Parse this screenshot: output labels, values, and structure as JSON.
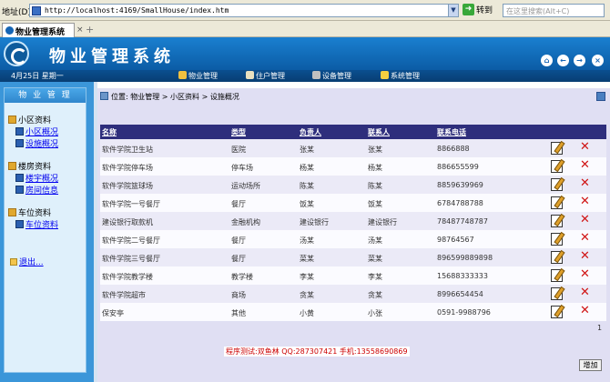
{
  "browser": {
    "address_label": "地址(D)",
    "url": "http://localhost:4169/SmallHouse/index.htm",
    "go_label": "转到",
    "search_placeholder": "在这里搜索(Alt+C)",
    "tab_title": "物业管理系统",
    "tab_close": "×",
    "tab_new": "+"
  },
  "header": {
    "app_title": "物业管理系统",
    "icons": [
      "home-icon",
      "back-icon",
      "forward-icon",
      "close-icon"
    ]
  },
  "nav": {
    "date": "4月25日 星期一",
    "items": [
      "物业管理",
      "住户管理",
      "设备管理",
      "系统管理"
    ]
  },
  "sidebar": {
    "title": "物 业 管 理",
    "groups": [
      {
        "label": "小区资料",
        "items": [
          "小区概况",
          "设施概况"
        ]
      },
      {
        "label": "楼房资料",
        "items": [
          "楼宇概况",
          "房间信息"
        ]
      },
      {
        "label": "车位资料",
        "items": [
          "车位资料"
        ]
      }
    ],
    "logout": "退出..."
  },
  "breadcrumb": "位置: 物业管理 > 小区资料 > 设施概况",
  "table": {
    "columns": [
      "名称",
      "类型",
      "负责人",
      "联系人",
      "联系电话"
    ],
    "rows": [
      [
        "软件学院卫生站",
        "医院",
        "张某",
        "张某",
        "8866888"
      ],
      [
        "软件学院停车场",
        "停车场",
        "杨某",
        "杨某",
        "886655599"
      ],
      [
        "软件学院篮球场",
        "运动场所",
        "陈某",
        "陈某",
        "8859639969"
      ],
      [
        "软件学院一号餐厅",
        "餐厅",
        "饭某",
        "饭某",
        "6784788788"
      ],
      [
        "建设银行取款机",
        "金融机构",
        "建设银行",
        "建设银行",
        "78487748787"
      ],
      [
        "软件学院二号餐厅",
        "餐厅",
        "汤某",
        "汤某",
        "98764567"
      ],
      [
        "软件学院三号餐厅",
        "餐厅",
        "菜某",
        "菜某",
        "896599889898"
      ],
      [
        "软件学院教学楼",
        "教学楼",
        "李某",
        "李某",
        "15688333333"
      ],
      [
        "软件学院超市",
        "商场",
        "贪某",
        "贪某",
        "8996654454"
      ],
      [
        "保安亭",
        "其他",
        "小黄",
        "小张",
        "0591-9988796"
      ]
    ]
  },
  "pagination": "1",
  "footer_note": "程序测试:双鱼林 QQ:287307421 手机:13558690869",
  "add_button": "增加",
  "colors": {
    "header_blue": "#0b5ca5",
    "table_header": "#2e2e7c",
    "delete_red": "#d01515"
  }
}
